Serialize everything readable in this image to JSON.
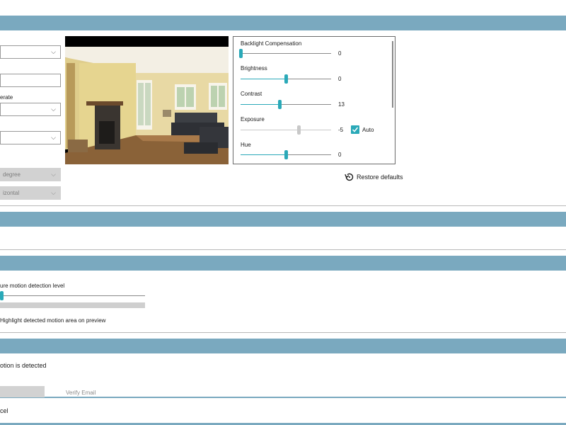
{
  "camera": {
    "dropdowns": [
      "",
      "",
      ""
    ],
    "frame_rate_label": "erate",
    "rotation_value": "degree",
    "flip_value": "izontal"
  },
  "image_controls": {
    "sliders": [
      {
        "label": "Backlight Compensation",
        "value": "0",
        "level": 0.0,
        "enabled": true
      },
      {
        "label": "Brightness",
        "value": "0",
        "level": 0.5,
        "enabled": true
      },
      {
        "label": "Contrast",
        "value": "13",
        "level": 0.43,
        "enabled": true
      },
      {
        "label": "Exposure",
        "value": "-5",
        "level": 0.64,
        "enabled": false
      },
      {
        "label": "Hue",
        "value": "0",
        "level": 0.5,
        "enabled": true
      }
    ],
    "exposure_auto_label": "Auto",
    "exposure_auto_checked": true,
    "restore_label": "Restore defaults"
  },
  "motion": {
    "sensitivity_label": "ure motion detection level",
    "sensitivity_level": 0.0,
    "highlight_label": "Highlight detected motion area on preview"
  },
  "alerts": {
    "trigger_label": "otion is detected",
    "verify_email_label": "Verify Email"
  },
  "footer": {
    "cancel_label": "cel"
  },
  "colors": {
    "band": "#7aa9bf",
    "accent": "#2aa9b8"
  }
}
